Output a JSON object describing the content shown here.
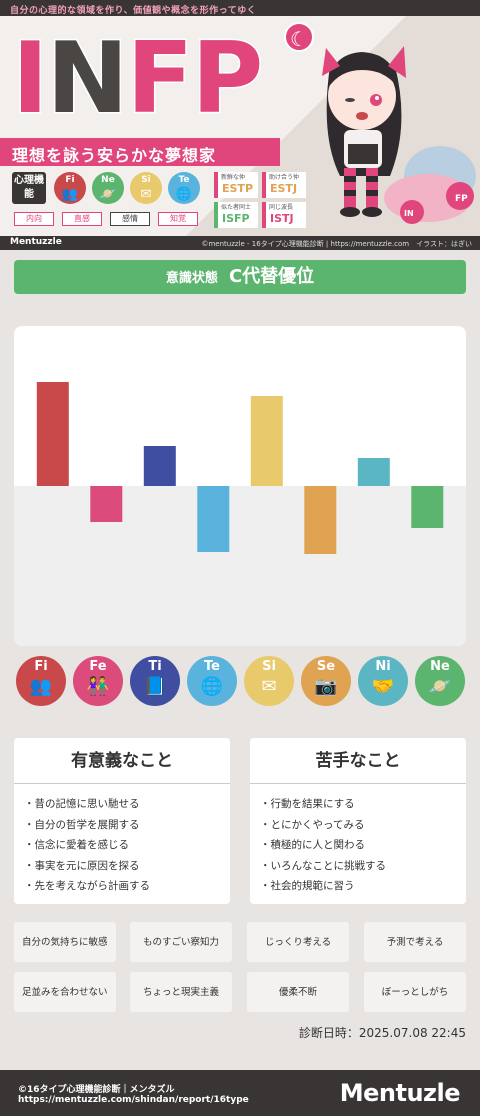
{
  "header": {
    "tagline": "自分の心理的な領域を作り、価値観や概念を形作ってゆく",
    "type_letters": [
      "I",
      "N",
      "F",
      "P"
    ],
    "moon_icon": "crescent-moon-icon",
    "subtitle": "理想を詠う安らかな夢想家",
    "cognitive_label": "心理機能",
    "functions": [
      {
        "code": "Fi",
        "icon": "people-icon",
        "color": "#c9484a"
      },
      {
        "code": "Ne",
        "icon": "planet-icon",
        "color": "#5bb56e"
      },
      {
        "code": "Si",
        "icon": "envelope-icon",
        "color": "#e8c96b"
      },
      {
        "code": "Te",
        "icon": "globe-icon",
        "color": "#5ab3dc"
      }
    ],
    "function_tags": [
      "内向",
      "直感",
      "感情",
      "知覚"
    ],
    "relations": [
      {
        "key": "新鮮な仲",
        "value": "ESTP"
      },
      {
        "key": "助け合う仲",
        "value": "ESTJ"
      },
      {
        "key": "似た者同士",
        "value": "ISFP"
      },
      {
        "key": "同じ波長",
        "value": "ISTJ"
      }
    ],
    "credit_logo": "Mentuzzle",
    "credit": "©mentuzzle - 16タイプ心理機能診断 | https://mentuzzle.com　イラスト：はぎい",
    "mascot_badge": "INFP"
  },
  "state": {
    "label": "意識状態",
    "value": "C代替優位"
  },
  "chart_data": {
    "type": "bar",
    "categories": [
      "Fi",
      "Fe",
      "Ti",
      "Te",
      "Si",
      "Se",
      "Ni",
      "Ne"
    ],
    "values": [
      52,
      -18,
      20,
      -33,
      45,
      -34,
      14,
      -21
    ],
    "colors": [
      "#c9484a",
      "#db4b7c",
      "#3f4ea0",
      "#5ab3dc",
      "#e8c96b",
      "#e0a352",
      "#5ab6c3",
      "#5bb56e"
    ],
    "ylim": [
      -80,
      80
    ],
    "grid": false,
    "title": "",
    "xlabel": "",
    "ylabel": ""
  },
  "functions_row": [
    {
      "code": "Fi",
      "icon": "people-icon",
      "color": "#c9484a"
    },
    {
      "code": "Fe",
      "icon": "family-icon",
      "color": "#db4b7c"
    },
    {
      "code": "Ti",
      "icon": "book-icon",
      "color": "#3f4ea0"
    },
    {
      "code": "Te",
      "icon": "globe-icon",
      "color": "#5ab3dc"
    },
    {
      "code": "Si",
      "icon": "envelope-icon",
      "color": "#e8c96b"
    },
    {
      "code": "Se",
      "icon": "camera-icon",
      "color": "#e0a352"
    },
    {
      "code": "Ni",
      "icon": "handshake-icon",
      "color": "#5ab6c3"
    },
    {
      "code": "Ne",
      "icon": "planet-icon",
      "color": "#5bb56e"
    }
  ],
  "meaningful": {
    "title": "有意義なこと",
    "items": [
      "・昔の記憶に思い馳せる",
      "・自分の哲学を展開する",
      "・信念に愛着を感じる",
      "・事実を元に原因を探る",
      "・先を考えながら計画する"
    ]
  },
  "weak": {
    "title": "苦手なこと",
    "items": [
      "・行動を結果にする",
      "・とにかくやってみる",
      "・積極的に人と関わる",
      "・いろんなことに挑戦する",
      "・社会的規範に習う"
    ]
  },
  "traits": [
    "自分の気持ちに敏感",
    "ものすごい察知力",
    "じっくり考える",
    "予測で考える",
    "足並みを合わせない",
    "ちょっと現実主義",
    "優柔不断",
    "ぼーっとしがち"
  ],
  "diagnosis_date": "診断日時：2025.07.08 22:45",
  "footer": {
    "line1": "©16タイプ心理機能診断｜メンタズル",
    "line2": "https://mentuzzle.com/shindan/report/16type",
    "brand": "Mentuzle"
  }
}
